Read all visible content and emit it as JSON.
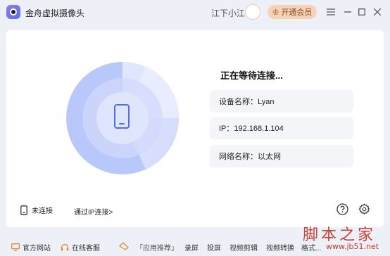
{
  "app": {
    "title": "金舟虚拟摄像头"
  },
  "user": {
    "name": "江下小江"
  },
  "vip_button": {
    "label": "开通会员"
  },
  "status": {
    "title": "正在等待连接..."
  },
  "info": {
    "device": "设备名称：Lyan",
    "ip": "IP：192.168.1.104",
    "network": "网络名称：以太网"
  },
  "bottom": {
    "connection": "未连接",
    "ip_connect": "通过IP连接>"
  },
  "footer": {
    "official": "官方网站",
    "support": "在线客服",
    "recommend": "「应用推荐」",
    "links": [
      "录屏",
      "投屏",
      "视频剪辑",
      "视频转换",
      "格式..."
    ]
  },
  "watermark": {
    "text": "脚本之家",
    "url": "www.jb51.net"
  },
  "colors": {
    "accent": "#5b74e8",
    "vip": "#f6d3b6",
    "radar": "#c9d4fb"
  }
}
